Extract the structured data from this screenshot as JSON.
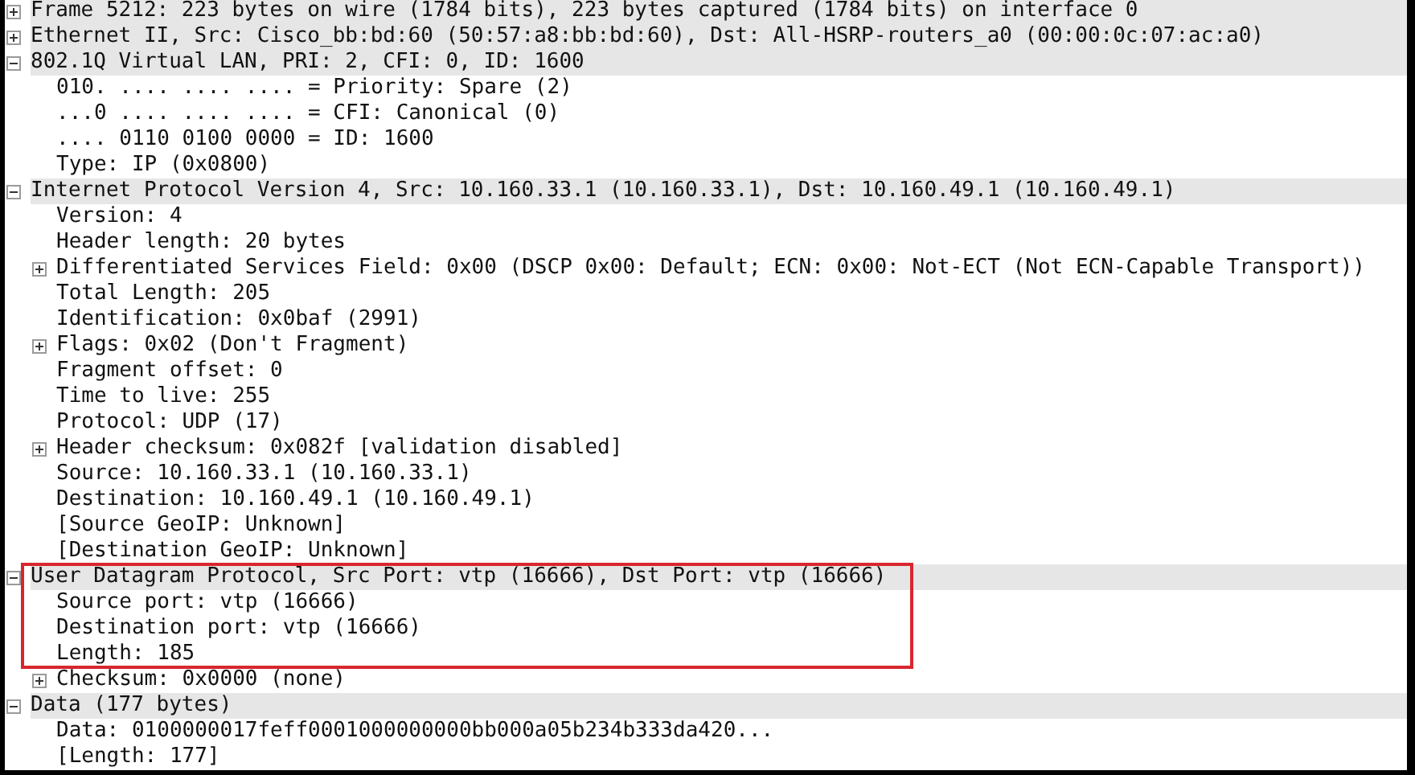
{
  "packet_details": [
    {
      "label": "Frame 5212: 223 bytes on wire (1784 bits), 223 bytes captured (1784 bits) on interface 0",
      "expanded": false,
      "highlighted": false
    },
    {
      "label": "Ethernet II, Src: Cisco_bb:bd:60 (50:57:a8:bb:bd:60), Dst: All-HSRP-routers_a0 (00:00:0c:07:ac:a0)",
      "expanded": false,
      "highlighted": false
    },
    {
      "label": "802.1Q Virtual LAN, PRI: 2, CFI: 0, ID: 1600",
      "expanded": true,
      "highlighted": false,
      "children": [
        {
          "label": "010. .... .... .... = Priority: Spare (2)",
          "highlighted": false
        },
        {
          "label": "...0 .... .... .... = CFI: Canonical (0)",
          "highlighted": false
        },
        {
          "label": ".... 0110 0100 0000 = ID: 1600",
          "highlighted": false
        },
        {
          "label": "Type: IP (0x0800)",
          "highlighted": false
        }
      ]
    },
    {
      "label": "Internet Protocol Version 4, Src: 10.160.33.1 (10.160.33.1), Dst: 10.160.49.1 (10.160.49.1)",
      "expanded": true,
      "highlighted": false,
      "children": [
        {
          "label": "Version: 4",
          "highlighted": false
        },
        {
          "label": "Header length: 20 bytes",
          "highlighted": false
        },
        {
          "label": "Differentiated Services Field: 0x00 (DSCP 0x00: Default; ECN: 0x00: Not-ECT (Not ECN-Capable Transport))",
          "expanded": false,
          "highlighted": false
        },
        {
          "label": "Total Length: 205",
          "highlighted": false
        },
        {
          "label": "Identification: 0x0baf (2991)",
          "highlighted": false
        },
        {
          "label": "Flags: 0x02 (Don't Fragment)",
          "expanded": false,
          "highlighted": false
        },
        {
          "label": "Fragment offset: 0",
          "highlighted": false
        },
        {
          "label": "Time to live: 255",
          "highlighted": false
        },
        {
          "label": "Protocol: UDP (17)",
          "highlighted": false
        },
        {
          "label": "Header checksum: 0x082f [validation disabled]",
          "expanded": false,
          "highlighted": false
        },
        {
          "label": "Source: 10.160.33.1 (10.160.33.1)",
          "highlighted": false
        },
        {
          "label": "Destination: 10.160.49.1 (10.160.49.1)",
          "highlighted": false
        },
        {
          "label": "[Source GeoIP: Unknown]",
          "highlighted": false
        },
        {
          "label": "[Destination GeoIP: Unknown]",
          "highlighted": false
        }
      ]
    },
    {
      "label": "User Datagram Protocol, Src Port: vtp (16666), Dst Port: vtp (16666)",
      "expanded": true,
      "highlighted": true,
      "children": [
        {
          "label": "Source port: vtp (16666)",
          "highlighted": true
        },
        {
          "label": "Destination port: vtp (16666)",
          "highlighted": true
        },
        {
          "label": "Length: 185",
          "highlighted": true
        },
        {
          "label": "Checksum: 0x0000 (none)",
          "expanded": false,
          "highlighted": false
        }
      ]
    },
    {
      "label": "Data (177 bytes)",
      "expanded": true,
      "highlighted": false,
      "children": [
        {
          "label": "Data: 0100000017feff0001000000000bb000a05b234b333da420...",
          "highlighted": false
        },
        {
          "label": "[Length: 177]",
          "highlighted": false
        }
      ]
    }
  ]
}
